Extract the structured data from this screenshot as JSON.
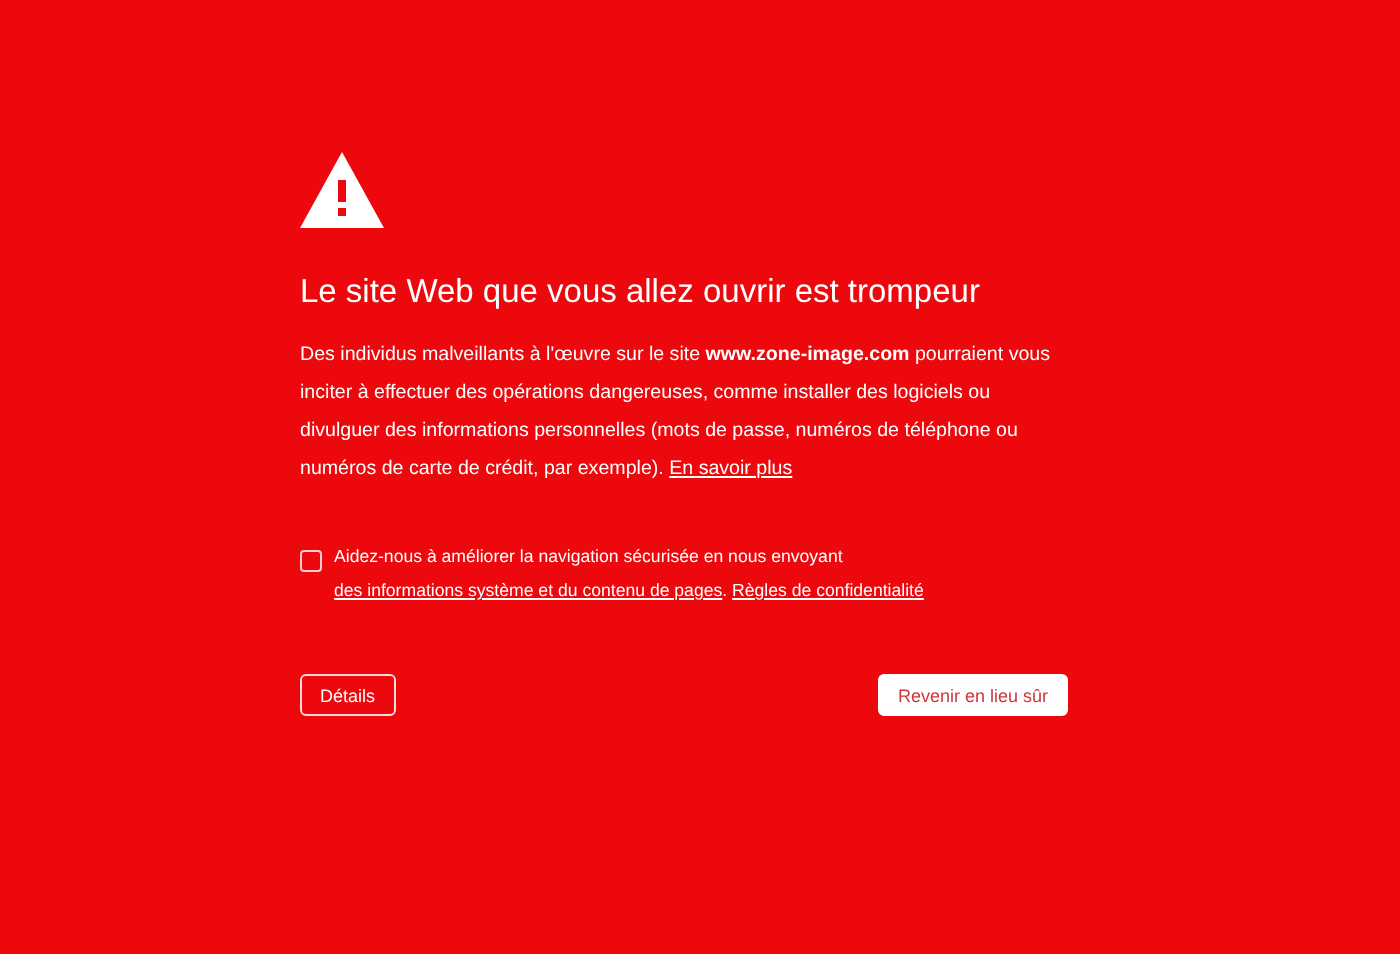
{
  "heading": "Le site Web que vous allez ouvrir est trompeur",
  "message": {
    "text": "Des individus malveillants à l'œuvre sur le site **www.zone-image.com** pourraient vous inciter à effectuer des opérations dangereuses, comme installer des logiciels ou divulguer des informations personnelles (mots de passe, numéros de téléphone ou numéros de carte de crédit, par exemple). ",
    "link": "En savoir plus"
  },
  "report": {
    "checked": false,
    "text": "Aidez-nous à améliorer la navigation sécurisée en nous envoyant ",
    "link": "des informations système et du contenu de pages",
    "separator": ". ",
    "privacy_link": "Règles de confidentialité"
  },
  "buttons": [
    {
      "kind": "outline",
      "label": "Détails"
    },
    {
      "kind": "filled",
      "label": "Revenir en lieu sûr"
    }
  ]
}
